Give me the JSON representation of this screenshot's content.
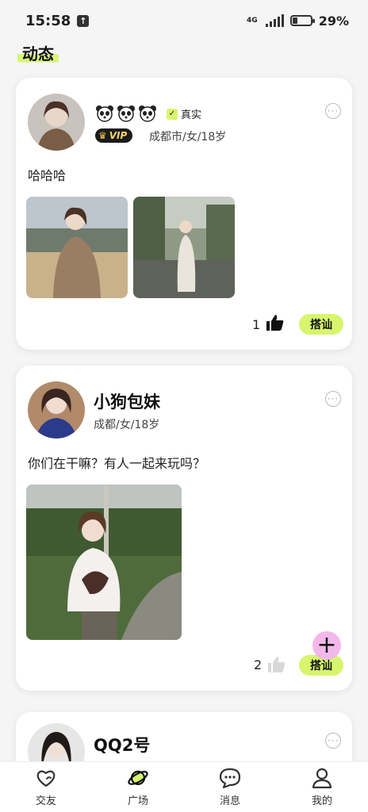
{
  "status": {
    "time": "15:58",
    "network": "4G",
    "battery": "29%",
    "battery_level": 0.29
  },
  "page": {
    "title": "动态"
  },
  "posts": [
    {
      "badge_verified": "真实",
      "vip": "VIP",
      "meta": "成都市/女/18岁",
      "text": "哈哈哈",
      "likes": "1",
      "chat_label": "搭讪"
    },
    {
      "name": "小狗包妹",
      "meta": "成都/女/18岁",
      "text": "你们在干嘛？有人一起来玩吗？",
      "likes": "2",
      "chat_label": "搭讪"
    },
    {
      "name": "QQ2号"
    }
  ],
  "nav": [
    {
      "label": "交友",
      "icon": "heart-friends-icon"
    },
    {
      "label": "广场",
      "icon": "planet-icon"
    },
    {
      "label": "消息",
      "icon": "chat-bubble-icon"
    },
    {
      "label": "我的",
      "icon": "person-icon"
    }
  ]
}
